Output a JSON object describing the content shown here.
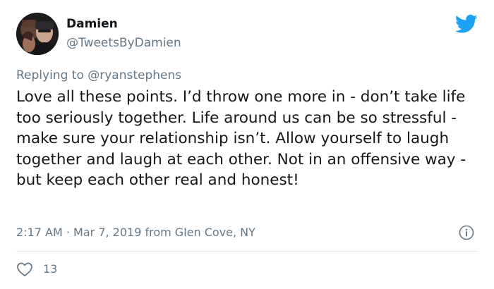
{
  "author": {
    "name": "Damien",
    "handle": "@TweetsByDamien"
  },
  "reply": {
    "prefix": "Replying to",
    "mention": "@ryanstephens"
  },
  "tweet": {
    "text": "Love all these points. I’d throw one more in - don’t take life too seriously together. Life around us can be so stressful - make sure your relationship isn’t. Allow yourself to laugh together and laugh at each other. Not in an offensive way - but keep each other real and honest!"
  },
  "meta": {
    "time": "2:17 AM",
    "separator": "·",
    "date": "Mar 7, 2019",
    "location": "from Glen Cove, NY"
  },
  "stats": {
    "likes": "13"
  },
  "icons": {
    "brand": "twitter-bird-icon",
    "info": "info-icon",
    "like": "heart-icon"
  },
  "colors": {
    "brand_blue": "#1da1f2",
    "text_primary": "#14171a",
    "text_secondary": "#657786",
    "divider": "#e1e8ed"
  }
}
